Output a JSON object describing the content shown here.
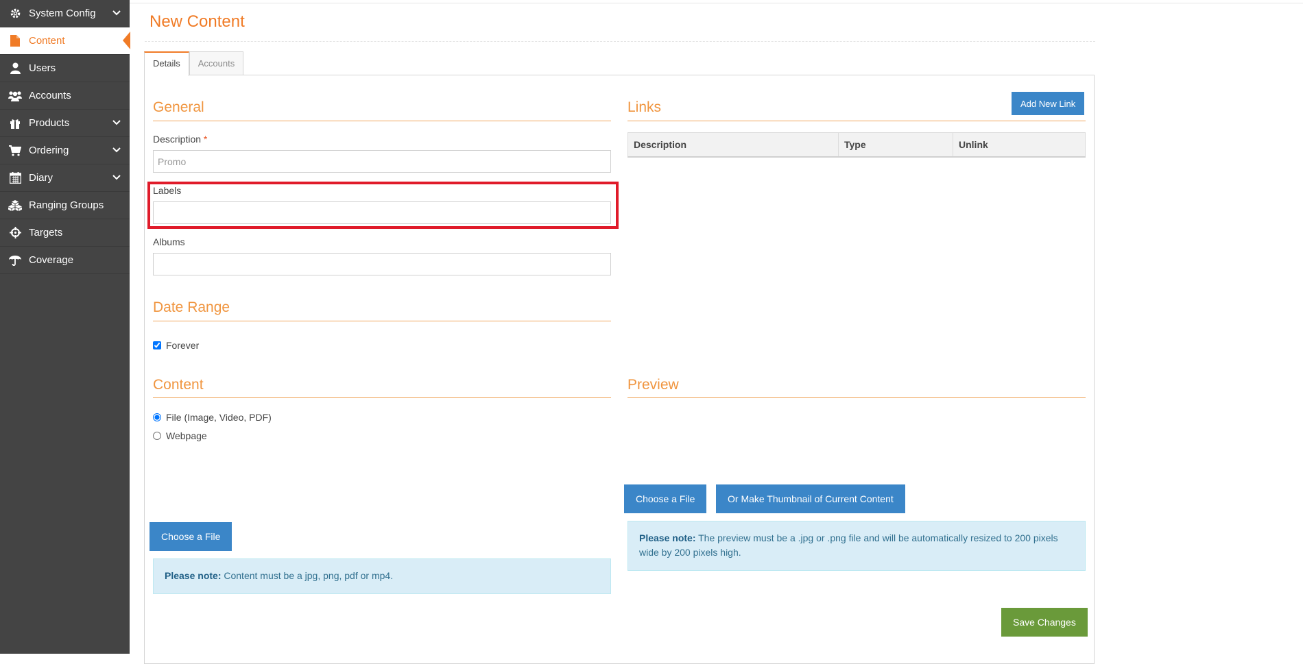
{
  "sidebar": {
    "items": [
      {
        "label": "System Config",
        "icon": "gear-icon",
        "expandable": true
      },
      {
        "label": "Content",
        "icon": "document-icon",
        "active": true
      },
      {
        "label": "Users",
        "icon": "user-icon"
      },
      {
        "label": "Accounts",
        "icon": "users-group-icon"
      },
      {
        "label": "Products",
        "icon": "gift-icon",
        "expandable": true
      },
      {
        "label": "Ordering",
        "icon": "cart-icon",
        "expandable": true
      },
      {
        "label": "Diary",
        "icon": "calendar-icon",
        "expandable": true
      },
      {
        "label": "Ranging Groups",
        "icon": "cubes-icon"
      },
      {
        "label": "Targets",
        "icon": "crosshair-icon"
      },
      {
        "label": "Coverage",
        "icon": "umbrella-icon"
      }
    ]
  },
  "page": {
    "title": "New Content"
  },
  "tabs": [
    {
      "label": "Details",
      "active": true
    },
    {
      "label": "Accounts"
    }
  ],
  "general": {
    "heading": "General",
    "description_label": "Description",
    "required_mark": "*",
    "description_placeholder": "Promo",
    "labels_label": "Labels",
    "labels_value": "",
    "albums_label": "Albums",
    "albums_value": ""
  },
  "date_range": {
    "heading": "Date Range",
    "forever_label": "Forever",
    "forever_checked": true
  },
  "content": {
    "heading": "Content",
    "options": [
      {
        "label": "File (Image, Video, PDF)",
        "selected": true
      },
      {
        "label": "Webpage",
        "selected": false
      }
    ],
    "choose_file_label": "Choose a File",
    "note_bold": "Please note:",
    "note_text": "Content must be a jpg, png, pdf or mp4."
  },
  "links": {
    "heading": "Links",
    "add_button": "Add New Link",
    "columns": [
      "Description",
      "Type",
      "Unlink"
    ]
  },
  "preview": {
    "heading": "Preview",
    "choose_file_label": "Choose a File",
    "thumbnail_label": "Or Make Thumbnail of Current Content",
    "note_bold": "Please note:",
    "note_text": "The preview must be a .jpg or .png file and will be automatically resized to 200 pixels wide by 200 pixels high."
  },
  "actions": {
    "save_label": "Save Changes"
  },
  "colors": {
    "accent": "#f07b26",
    "primary": "#3b86c8",
    "success": "#6a9a3a",
    "sidebar": "#444444",
    "highlight": "#e01b2a"
  }
}
